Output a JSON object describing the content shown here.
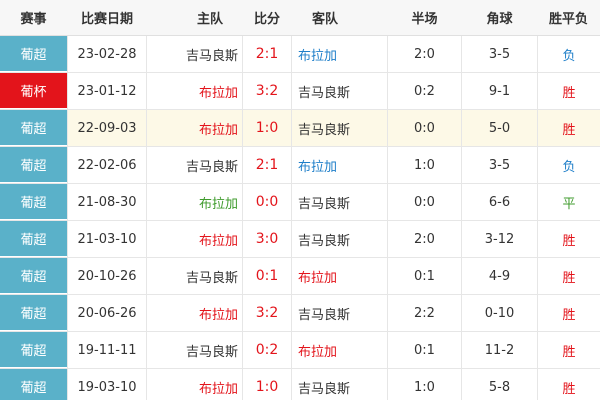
{
  "header": {
    "league": "赛事",
    "date": "比赛日期",
    "home": "主队",
    "score": "比分",
    "away": "客队",
    "half": "半场",
    "corner": "角球",
    "result": "胜平负"
  },
  "colors": {
    "red": "#e3141b",
    "blue": "#1f7fc9",
    "green": "#3f9b2c",
    "dark": "#333333",
    "league_bg": "#5ab1c9",
    "cup_bg": "#e3141b",
    "highlight_bg": "#fdf9e7"
  },
  "rows": [
    {
      "league": "葡超",
      "date": "23-02-28",
      "home": "吉马良斯",
      "score": "2:1",
      "away": "布拉加",
      "half": "2:0",
      "corner": "3-5",
      "result": "负"
    },
    {
      "league": "葡杯",
      "date": "23-01-12",
      "home": "布拉加",
      "score": "3:2",
      "away": "吉马良斯",
      "half": "0:2",
      "corner": "9-1",
      "result": "胜"
    },
    {
      "league": "葡超",
      "date": "22-09-03",
      "home": "布拉加",
      "score": "1:0",
      "away": "吉马良斯",
      "half": "0:0",
      "corner": "5-0",
      "result": "胜"
    },
    {
      "league": "葡超",
      "date": "22-02-06",
      "home": "吉马良斯",
      "score": "2:1",
      "away": "布拉加",
      "half": "1:0",
      "corner": "3-5",
      "result": "负"
    },
    {
      "league": "葡超",
      "date": "21-08-30",
      "home": "布拉加",
      "score": "0:0",
      "away": "吉马良斯",
      "half": "0:0",
      "corner": "6-6",
      "result": "平"
    },
    {
      "league": "葡超",
      "date": "21-03-10",
      "home": "布拉加",
      "score": "3:0",
      "away": "吉马良斯",
      "half": "2:0",
      "corner": "3-12",
      "result": "胜"
    },
    {
      "league": "葡超",
      "date": "20-10-26",
      "home": "吉马良斯",
      "score": "0:1",
      "away": "布拉加",
      "half": "0:1",
      "corner": "4-9",
      "result": "胜"
    },
    {
      "league": "葡超",
      "date": "20-06-26",
      "home": "布拉加",
      "score": "3:2",
      "away": "吉马良斯",
      "half": "2:2",
      "corner": "0-10",
      "result": "胜"
    },
    {
      "league": "葡超",
      "date": "19-11-11",
      "home": "吉马良斯",
      "score": "0:2",
      "away": "布拉加",
      "half": "0:1",
      "corner": "11-2",
      "result": "胜"
    },
    {
      "league": "葡超",
      "date": "19-03-10",
      "home": "布拉加",
      "score": "1:0",
      "away": "吉马良斯",
      "half": "1:0",
      "corner": "5-8",
      "result": "胜"
    }
  ]
}
